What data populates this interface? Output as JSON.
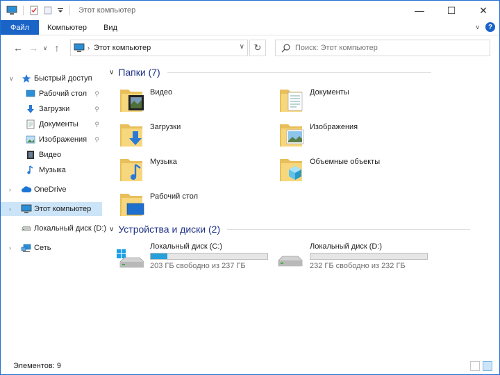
{
  "window": {
    "title": "Этот компьютер",
    "accent": "#1a63c7",
    "minimize": "—",
    "maximize": "☐",
    "close": "✕"
  },
  "ribbon": {
    "tabs": [
      {
        "label": "Файл"
      },
      {
        "label": "Компьютер"
      },
      {
        "label": "Вид"
      }
    ],
    "help_label": "?"
  },
  "nav": {
    "address": "Этот компьютер",
    "search_placeholder": "Поиск: Этот компьютер"
  },
  "sidebar": {
    "items": [
      {
        "label": "Быстрый доступ",
        "icon": "star-icon"
      },
      {
        "label": "Рабочий стол",
        "icon": "desktop-icon"
      },
      {
        "label": "Загрузки",
        "icon": "download-icon"
      },
      {
        "label": "Документы",
        "icon": "document-icon"
      },
      {
        "label": "Изображения",
        "icon": "image-icon"
      },
      {
        "label": "Видео",
        "icon": "video-icon"
      },
      {
        "label": "Музыка",
        "icon": "music-icon"
      },
      {
        "label": "OneDrive",
        "icon": "cloud-icon"
      },
      {
        "label": "Этот компьютер",
        "icon": "computer-icon"
      },
      {
        "label": "Локальный диск (D:)",
        "icon": "drive-icon"
      },
      {
        "label": "Сеть",
        "icon": "network-icon"
      }
    ]
  },
  "main": {
    "folders_header": "Папки (7)",
    "folders": [
      {
        "label": "Видео",
        "icon": "video-folder-icon"
      },
      {
        "label": "Документы",
        "icon": "documents-folder-icon"
      },
      {
        "label": "Загрузки",
        "icon": "downloads-folder-icon"
      },
      {
        "label": "Изображения",
        "icon": "pictures-folder-icon"
      },
      {
        "label": "Музыка",
        "icon": "music-folder-icon"
      },
      {
        "label": "Объемные объекты",
        "icon": "3d-objects-folder-icon"
      },
      {
        "label": "Рабочий стол",
        "icon": "desktop-folder-icon"
      }
    ],
    "drives_header": "Устройства и диски (2)",
    "drives": [
      {
        "label": "Локальный диск (C:)",
        "free": "203 ГБ свободно из 237 ГБ",
        "used_fraction": 0.14,
        "icon": "system-drive-icon"
      },
      {
        "label": "Локальный диск (D:)",
        "free": "232 ГБ свободно из 232 ГБ",
        "used_fraction": 0.0,
        "icon": "drive-icon"
      }
    ]
  },
  "status": {
    "items": "Элементов: 9"
  }
}
